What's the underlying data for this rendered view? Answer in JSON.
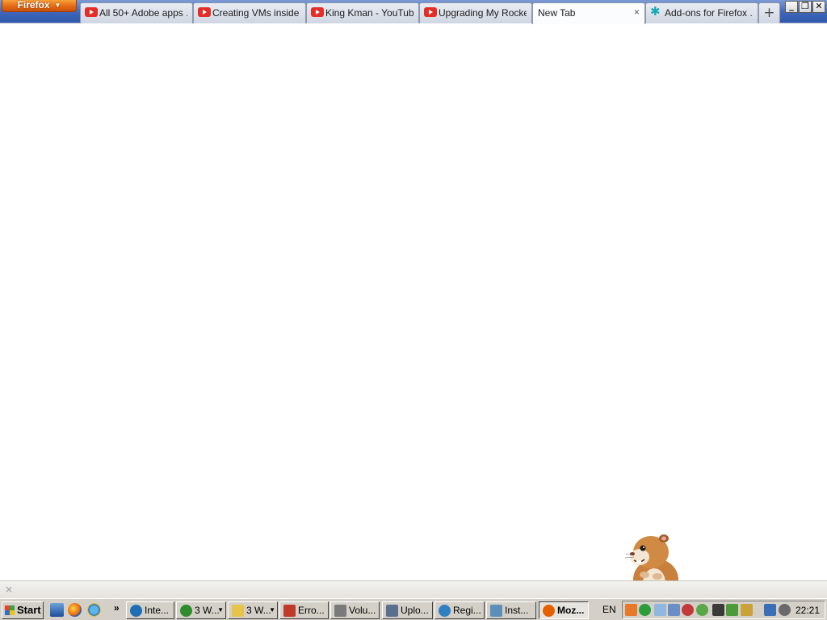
{
  "browser": {
    "menu_button": "Firefox",
    "tabs": [
      {
        "label": "All 50+ Adobe apps ...",
        "icon": "youtube-icon"
      },
      {
        "label": "Creating VMs inside ...",
        "icon": "youtube-icon"
      },
      {
        "label": "King Kman - YouTube",
        "icon": "youtube-icon"
      },
      {
        "label": "Upgrading My Rocke...",
        "icon": "youtube-icon"
      },
      {
        "label": "New Tab",
        "icon": "",
        "selected": true,
        "close": "×"
      },
      {
        "label": "Add-ons for Firefox ...",
        "icon": "puzzle-icon"
      }
    ],
    "new_tab": "+",
    "window_controls": {
      "minimize": "_",
      "restore": "❐",
      "close": "✕"
    }
  },
  "statusbar": {
    "close": "×"
  },
  "taskbar": {
    "start": "Start",
    "quick_launch_more": "»",
    "tasks": [
      {
        "label": "Inte...",
        "icon": "ie-icon",
        "color": "#1f6fb5"
      },
      {
        "label": "3 W...",
        "icon": "msn-icon",
        "color": "#2e8b2e",
        "dropdown": true
      },
      {
        "label": "3 W...",
        "icon": "folder-icon",
        "color": "#e8c34a",
        "dropdown": true
      },
      {
        "label": "Erro...",
        "icon": "java-icon",
        "color": "#c0392b"
      },
      {
        "label": "Volu...",
        "icon": "volume-icon",
        "color": "#7a7a7a"
      },
      {
        "label": "Uplo...",
        "icon": "window-icon",
        "color": "#5a6f8f"
      },
      {
        "label": "Regi...",
        "icon": "globe-icon",
        "color": "#2f7fc1"
      },
      {
        "label": "Inst...",
        "icon": "installer-icon",
        "color": "#5c8fb8"
      },
      {
        "label": "Moz...",
        "icon": "firefox-icon",
        "color": "#e66000",
        "active": true
      }
    ],
    "language": "EN",
    "clock": "22:21"
  }
}
